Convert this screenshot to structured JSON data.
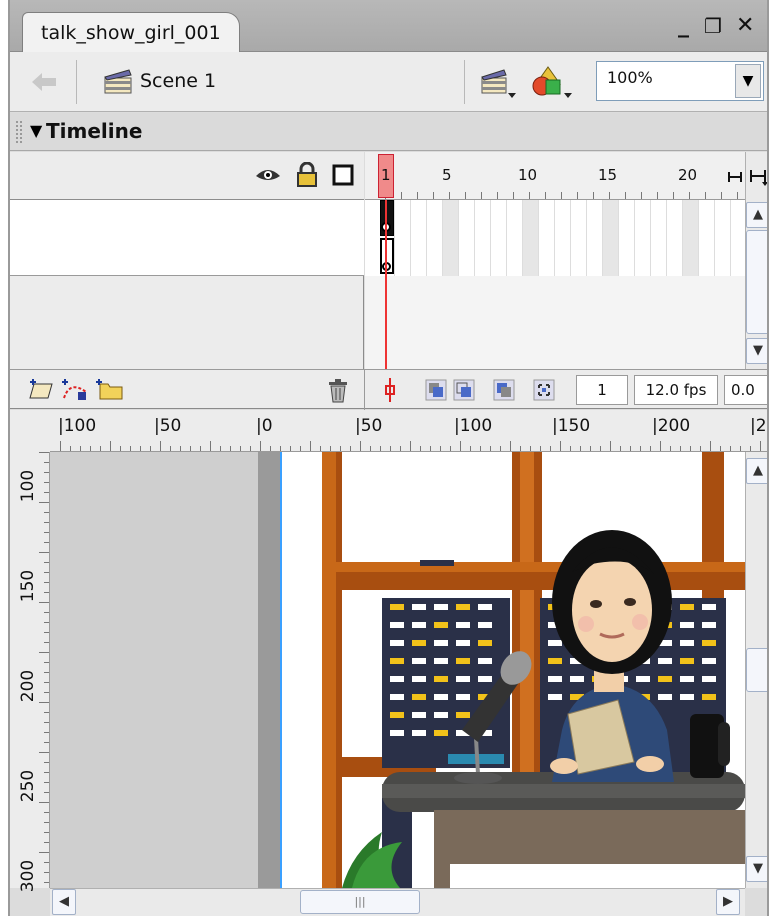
{
  "window": {
    "doc_tab": "talk_show_girl_001",
    "minimize_glyph": "_",
    "restore_glyph": "❐",
    "close_glyph": "✕"
  },
  "editbar": {
    "back_icon": "back-arrow-icon",
    "scene_icon": "clapperboard-icon",
    "scene_label": "Scene 1",
    "edit_scene_icon": "edit-scene-icon",
    "edit_symbols_icon": "edit-symbols-icon",
    "zoom_value": "100%",
    "zoom_arrow": "▼"
  },
  "timeline": {
    "collapse_glyph": "▼",
    "title": "Timeline",
    "header_icons": [
      "eye-icon",
      "lock-icon",
      "outline-square-icon"
    ],
    "ruler_numbers": [
      "1",
      "5",
      "10",
      "15",
      "20"
    ],
    "bottom_icons": [
      "insert-layer-icon",
      "add-motion-guide-icon",
      "insert-folder-icon",
      "trash-icon"
    ],
    "current_frame": "1",
    "frame_rate": "12.0 fps",
    "elapsed": "0.0"
  },
  "stage": {
    "h_ruler": [
      "|100",
      "|50",
      "|0",
      "|50",
      "|100",
      "|150",
      "|200",
      "|2"
    ],
    "v_ruler": [
      "100",
      "150",
      "200",
      "250",
      "300"
    ],
    "hscroll_grip": "|||"
  },
  "colors": {
    "frame_wood": "#a84e10",
    "building_dark": "#2a3048",
    "window_white": "#ffffff",
    "window_yellow": "#f2c21a",
    "desk": "#4a4a48",
    "jacket": "#2e4a78"
  }
}
